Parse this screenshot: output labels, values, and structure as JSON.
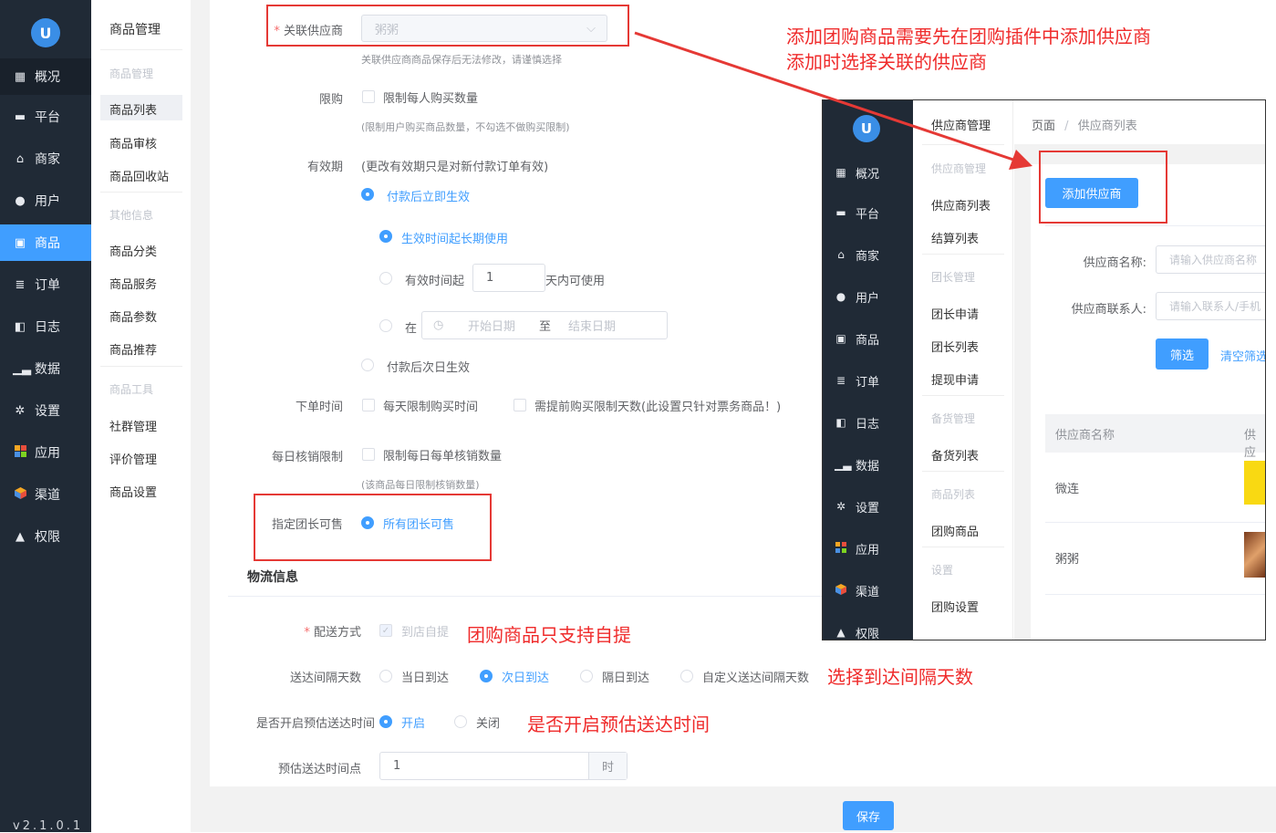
{
  "sidebar": {
    "logo": "U",
    "items": [
      {
        "label": "概况",
        "icon": "dashboard-icon"
      },
      {
        "label": "平台",
        "icon": "monitor-icon"
      },
      {
        "label": "商家",
        "icon": "store-icon"
      },
      {
        "label": "用户",
        "icon": "user-icon"
      },
      {
        "label": "商品",
        "icon": "goods-icon"
      },
      {
        "label": "订单",
        "icon": "order-icon"
      },
      {
        "label": "日志",
        "icon": "log-icon"
      },
      {
        "label": "数据",
        "icon": "chart-icon"
      },
      {
        "label": "设置",
        "icon": "gear-icon"
      },
      {
        "label": "应用",
        "icon": "apps-icon"
      },
      {
        "label": "渠道",
        "icon": "channel-icon"
      },
      {
        "label": "权限",
        "icon": "lock-icon"
      }
    ],
    "version": "v2.1.0.1"
  },
  "submenu": {
    "title": "商品管理",
    "group1": "商品管理",
    "items1": [
      "商品列表",
      "商品审核",
      "商品回收站"
    ],
    "group2": "其他信息",
    "items2": [
      "商品分类",
      "商品服务",
      "商品参数",
      "商品推荐"
    ],
    "group3": "商品工具",
    "items3": [
      "社群管理",
      "评价管理",
      "商品设置"
    ]
  },
  "form": {
    "supplier_label": "关联供应商",
    "supplier_value": "粥粥",
    "supplier_hint": "关联供应商商品保存后无法修改，请谨慎选择",
    "limit_label": "限购",
    "limit_option": "限制每人购买数量",
    "limit_hint": "(限制用户购买商品数量，不勾选不做购买限制)",
    "validity_label": "有效期",
    "validity_note": "(更改有效期只是对新付款订单有效)",
    "validity_opt1": "付款后立即生效",
    "validity_sub1": "生效时间起长期使用",
    "validity_sub2_pre": "有效时间起",
    "validity_sub2_value": "1",
    "validity_sub2_post": "天内可使用",
    "validity_sub3_pre": "在",
    "date_start": "开始日期",
    "date_sep": "至",
    "date_end": "结束日期",
    "validity_opt2": "付款后次日生效",
    "order_time_label": "下单时间",
    "order_time_opt1": "每天限制购买时间",
    "order_time_opt2": "需提前购买限制天数(此设置只针对票务商品！)",
    "daily_label": "每日核销限制",
    "daily_opt": "限制每日每单核销数量",
    "daily_hint": "(该商品每日限制核销数量)",
    "leader_label": "指定团长可售",
    "leader_opt": "所有团长可售",
    "logistics_title": "物流信息",
    "delivery_label": "配送方式",
    "delivery_opt": "到店自提",
    "interval_label": "送达间隔天数",
    "interval_opts": [
      "当日到达",
      "次日到达",
      "隔日到达",
      "自定义送达间隔天数"
    ],
    "estimate_label": "是否开启预估送达时间",
    "estimate_on": "开启",
    "estimate_off": "关闭",
    "time_point_label": "预估送达时间点",
    "time_point_value": "1",
    "time_point_unit": "时",
    "save_label": "保存"
  },
  "annotations": {
    "top_line1": "添加团购商品需要先在团购插件中添加供应商",
    "top_line2": "添加时选择关联的供应商",
    "delivery": "团购商品只支持自提",
    "interval": "选择到达间隔天数",
    "estimate": "是否开启预估送达时间"
  },
  "inset": {
    "logo": "U",
    "nav": [
      {
        "label": "概况",
        "icon": "dashboard-icon"
      },
      {
        "label": "平台",
        "icon": "monitor-icon"
      },
      {
        "label": "商家",
        "icon": "store-icon"
      },
      {
        "label": "用户",
        "icon": "user-icon"
      },
      {
        "label": "商品",
        "icon": "goods-icon"
      },
      {
        "label": "订单",
        "icon": "order-icon"
      },
      {
        "label": "日志",
        "icon": "log-icon"
      },
      {
        "label": "数据",
        "icon": "chart-icon"
      },
      {
        "label": "设置",
        "icon": "gear-icon"
      },
      {
        "label": "应用",
        "icon": "apps-icon"
      },
      {
        "label": "渠道",
        "icon": "channel-icon"
      },
      {
        "label": "权限",
        "icon": "lock-icon"
      }
    ],
    "submenu_title": "供应商管理",
    "sub_groups": [
      "供应商管理",
      "团长管理",
      "备货管理",
      "商品列表",
      "设置"
    ],
    "sub_items": [
      "供应商列表",
      "结算列表",
      "团长申请",
      "团长列表",
      "提现申请",
      "备货列表",
      "团购商品",
      "团购设置"
    ],
    "breadcrumb_root": "页面",
    "breadcrumb_sep": "/",
    "breadcrumb_current": "供应商列表",
    "add_button": "添加供应商",
    "name_label": "供应商名称:",
    "name_placeholder": "请输入供应商名称",
    "contact_label": "供应商联系人:",
    "contact_placeholder": "请输入联系人/手机",
    "filter_button": "筛选",
    "clear_button": "清空筛选",
    "col_name": "供应商名称",
    "col_next": "供应",
    "rows": [
      "微连",
      "粥粥"
    ]
  }
}
